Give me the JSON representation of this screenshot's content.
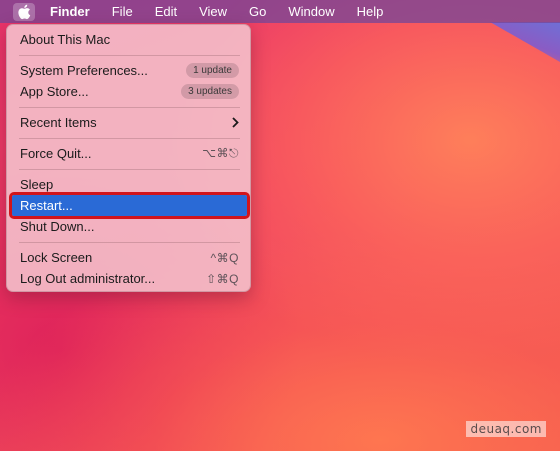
{
  "menubar": {
    "apple_icon": "apple-logo-icon",
    "items": [
      "Finder",
      "File",
      "Edit",
      "View",
      "Go",
      "Window",
      "Help"
    ]
  },
  "apple_menu": {
    "about": "About This Mac",
    "system_preferences": {
      "label": "System Preferences...",
      "badge": "1 update"
    },
    "app_store": {
      "label": "App Store...",
      "badge": "3 updates"
    },
    "recent_items": {
      "label": "Recent Items",
      "icon": "chevron-right-icon"
    },
    "force_quit": {
      "label": "Force Quit...",
      "shortcut": "⌥⌘⎋"
    },
    "sleep": "Sleep",
    "restart": "Restart...",
    "shut_down": "Shut Down...",
    "lock_screen": {
      "label": "Lock Screen",
      "shortcut": "^⌘Q"
    },
    "log_out": {
      "label": "Log Out administrator...",
      "shortcut": "⇧⌘Q"
    }
  },
  "watermark": "deuaq.com",
  "colors": {
    "highlight": "#2a6ad6",
    "annotation_border": "#d2141b",
    "menubar": "#7a4696"
  }
}
